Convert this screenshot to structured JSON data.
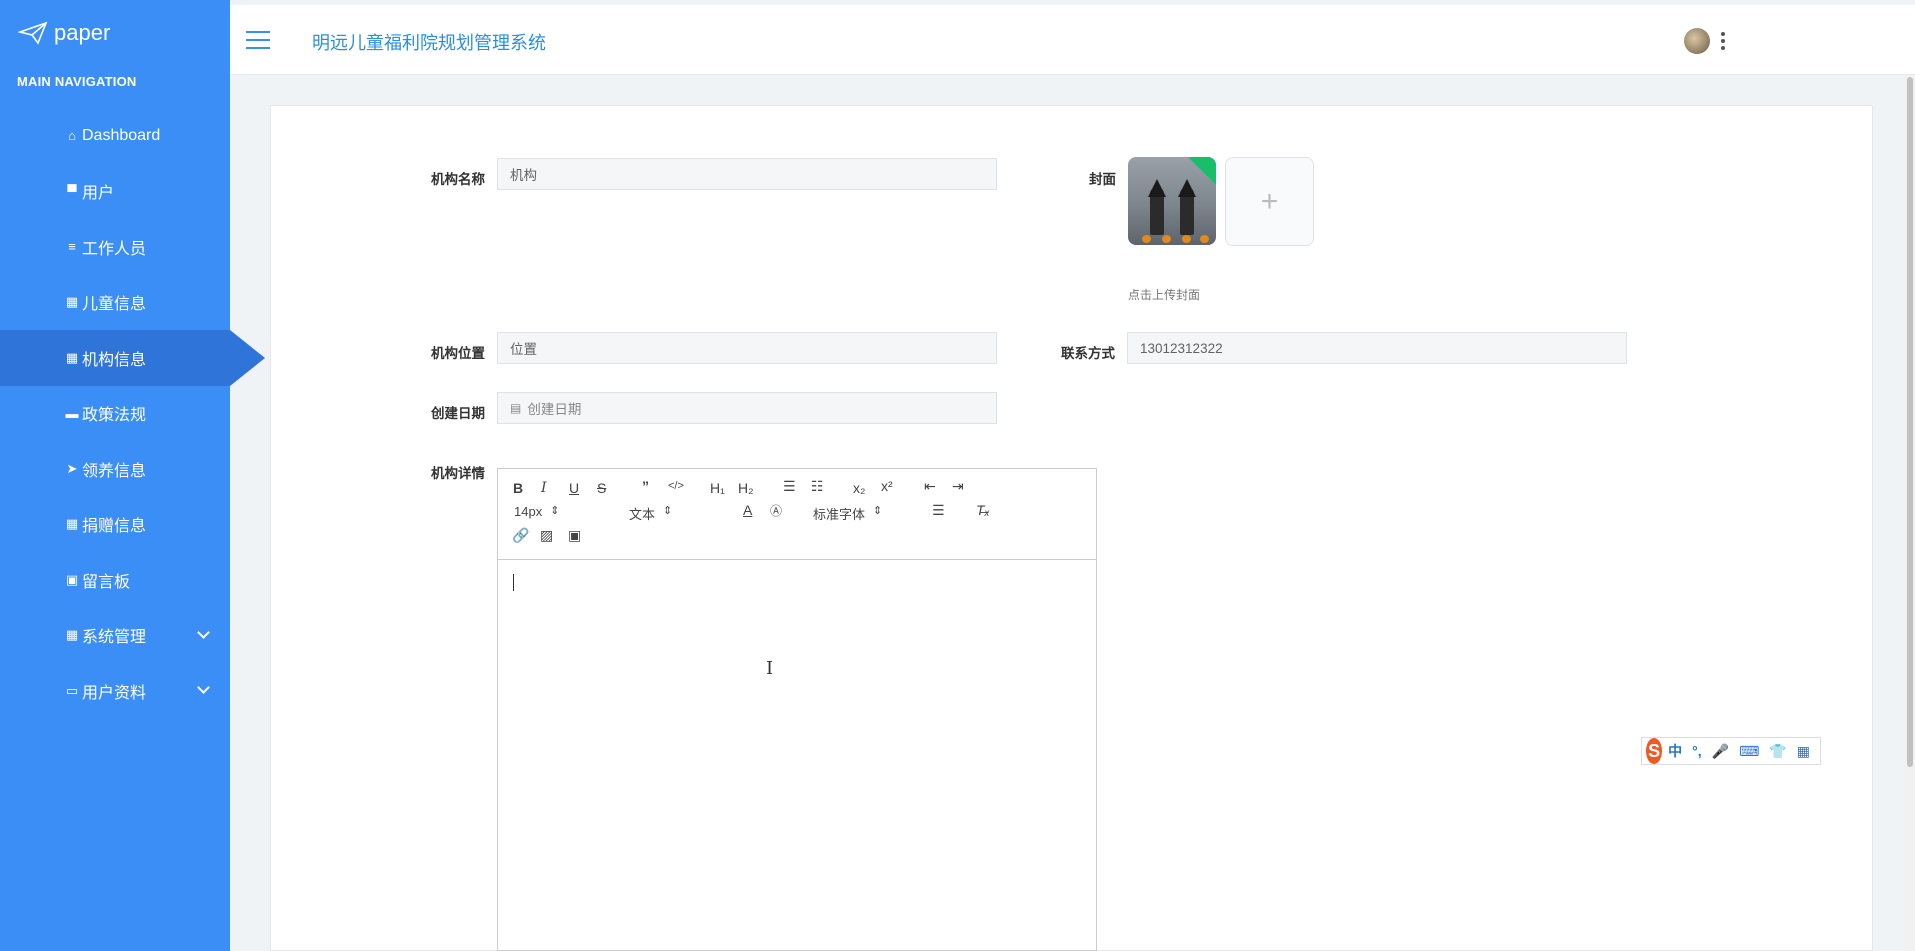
{
  "brand": {
    "name": "paper"
  },
  "nav": {
    "title": "MAIN NAVIGATION",
    "items": [
      {
        "label": "Dashboard",
        "icon": "home-icon"
      },
      {
        "label": "用户",
        "icon": "monitor-icon"
      },
      {
        "label": "工作人员",
        "icon": "list-icon"
      },
      {
        "label": "儿童信息",
        "icon": "grid-icon"
      },
      {
        "label": "机构信息",
        "icon": "table-icon",
        "active": true
      },
      {
        "label": "政策法规",
        "icon": "comment-icon"
      },
      {
        "label": "领养信息",
        "icon": "send-icon"
      },
      {
        "label": "捐赠信息",
        "icon": "grid-icon"
      },
      {
        "label": "留言板",
        "icon": "clipboard-icon"
      },
      {
        "label": "系统管理",
        "icon": "grid-icon",
        "expandable": true
      },
      {
        "label": "用户资料",
        "icon": "card-icon",
        "expandable": true
      }
    ]
  },
  "header": {
    "title": "明远儿童福利院规划管理系统"
  },
  "form": {
    "name_label": "机构名称",
    "name_value": "机构",
    "cover_label": "封面",
    "cover_hint": "点击上传封面",
    "location_label": "机构位置",
    "location_value": "位置",
    "contact_label": "联系方式",
    "contact_value": "13012312322",
    "date_label": "创建日期",
    "date_placeholder": "创建日期",
    "detail_label": "机构详情"
  },
  "editor": {
    "font_size": "14px",
    "header_select": "文本",
    "font_family": "标准字体",
    "tools_row1": [
      "B",
      "I",
      "U",
      "S",
      "99",
      "</>",
      "H1",
      "H2",
      "ol",
      "ul",
      "x2",
      "x2sup",
      "outdent",
      "indent"
    ],
    "tools_row3": [
      "link",
      "image",
      "video"
    ]
  },
  "ime": {
    "label": "中"
  },
  "colors": {
    "sidebar": "#3b8ef5",
    "sidebar_active": "#2f74d9",
    "title": "#2b8fe0"
  }
}
